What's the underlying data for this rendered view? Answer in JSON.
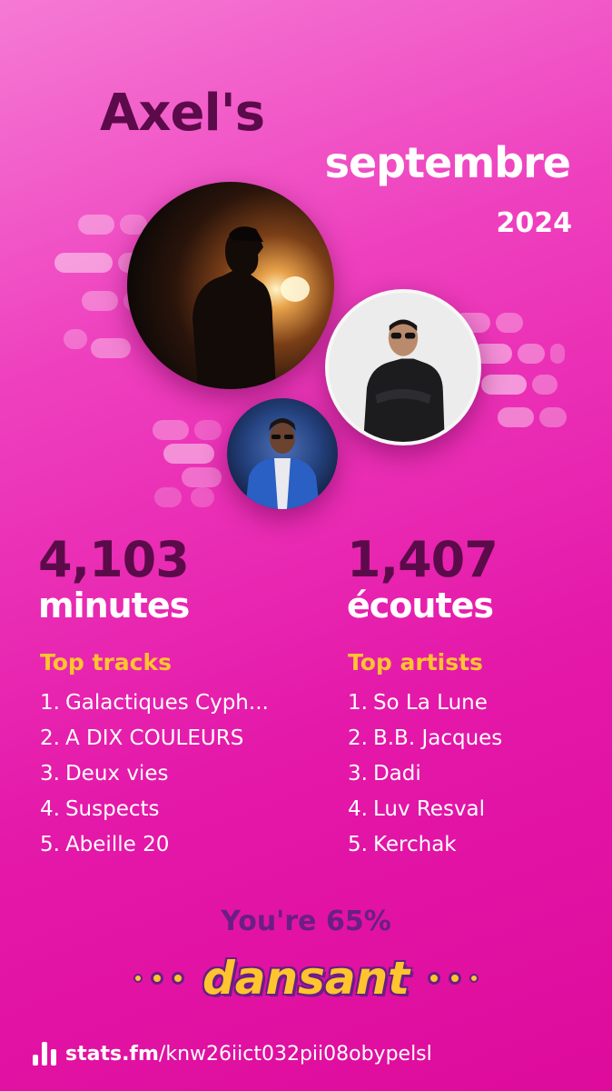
{
  "header": {
    "owner": "Axel's",
    "month": "septembre",
    "year": "2024"
  },
  "images": [
    {
      "icon": "artist-photo-concert-silhouette"
    },
    {
      "icon": "artist-photo-man-black-coat"
    },
    {
      "icon": "artist-photo-man-blue-jacket"
    }
  ],
  "stats": {
    "minutes_value": "4,103",
    "minutes_label": "minutes",
    "streams_value": "1,407",
    "streams_label": "écoutes"
  },
  "top_tracks": {
    "title": "Top tracks",
    "items": [
      {
        "rank": "1.",
        "name": "Galactiques Cyph..."
      },
      {
        "rank": "2.",
        "name": "A DIX COULEURS"
      },
      {
        "rank": "3.",
        "name": "Deux vies"
      },
      {
        "rank": "4.",
        "name": "Suspects"
      },
      {
        "rank": "5.",
        "name": "Abeille 20"
      }
    ]
  },
  "top_artists": {
    "title": "Top artists",
    "items": [
      {
        "rank": "1.",
        "name": "So La Lune"
      },
      {
        "rank": "2.",
        "name": "B.B. Jacques"
      },
      {
        "rank": "3.",
        "name": "Dadi"
      },
      {
        "rank": "4.",
        "name": "Luv Resval"
      },
      {
        "rank": "5.",
        "name": "Kerchak"
      }
    ]
  },
  "taste": {
    "line": "You're 65%",
    "mood": "dansant"
  },
  "footer": {
    "brand": "stats.fm",
    "path": "/knw26iict032pii08obypelsl",
    "icon": "stats-fm-logo-icon"
  },
  "colors": {
    "background_top": "#f57ad4",
    "background_bottom": "#de0b9c",
    "dark_text": "#5c0b4a",
    "accent_yellow": "#ffc42e",
    "accent_purple": "#6a1e86",
    "white": "#ffffff"
  }
}
